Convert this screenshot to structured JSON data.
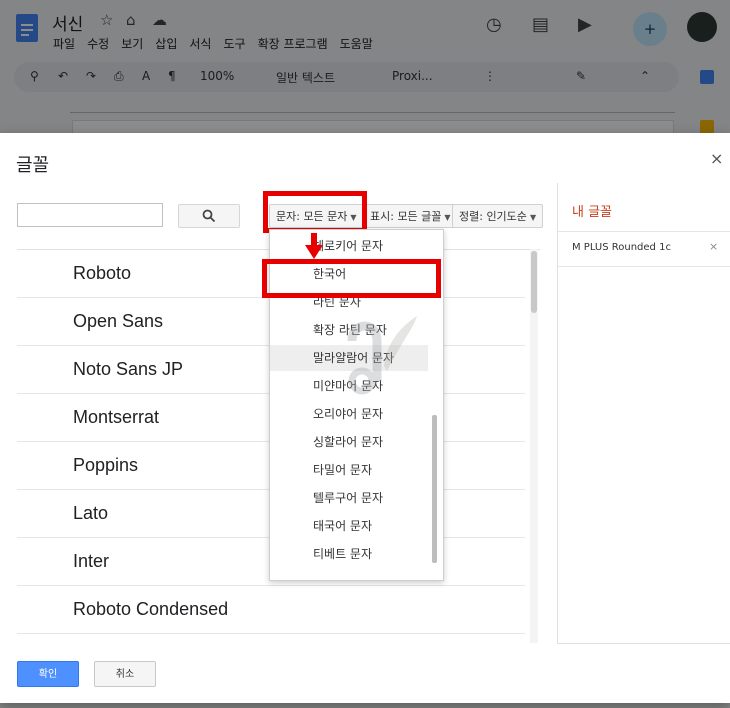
{
  "app": {
    "doc_title": "서신",
    "menu": [
      "파일",
      "수정",
      "보기",
      "삽입",
      "서식",
      "도구",
      "확장 프로그램",
      "도움말"
    ],
    "toolbar": {
      "zoom": "100%",
      "style": "일반 텍스트",
      "font": "Proxi..."
    }
  },
  "dialog": {
    "title": "글꼴",
    "close": "×",
    "search": {
      "value": "",
      "placeholder": ""
    },
    "filters": {
      "script": "문자: 모든 문자",
      "show": "표시: 모든 글꼴",
      "sort": "정렬: 인기도순"
    },
    "fonts": [
      "Roboto",
      "Open Sans",
      "Noto Sans JP",
      "Montserrat",
      "Poppins",
      "Lato",
      "Inter",
      "Roboto Condensed"
    ],
    "my_fonts": {
      "title": "내 글꼴",
      "items": [
        {
          "name": "M PLUS Rounded 1c",
          "remove": "×"
        }
      ]
    },
    "ok": "확인",
    "cancel": "취소"
  },
  "script_menu": {
    "items": [
      "체로키어 문자",
      "한국어",
      "라틴 문자",
      "확장 라틴 문자",
      "말라얄람어 문자",
      "미얀마어 문자",
      "오리야어 문자",
      "싱할라어 문자",
      "타밀어 문자",
      "텔루구어 문자",
      "태국어 문자",
      "티베트 문자"
    ],
    "highlighted": "말라얄람어 문자",
    "annotated": "한국어"
  },
  "colors": {
    "annotation_red": "#e60000",
    "my_fonts_title": "#c5401b",
    "ok_button": "#4d90fe"
  }
}
